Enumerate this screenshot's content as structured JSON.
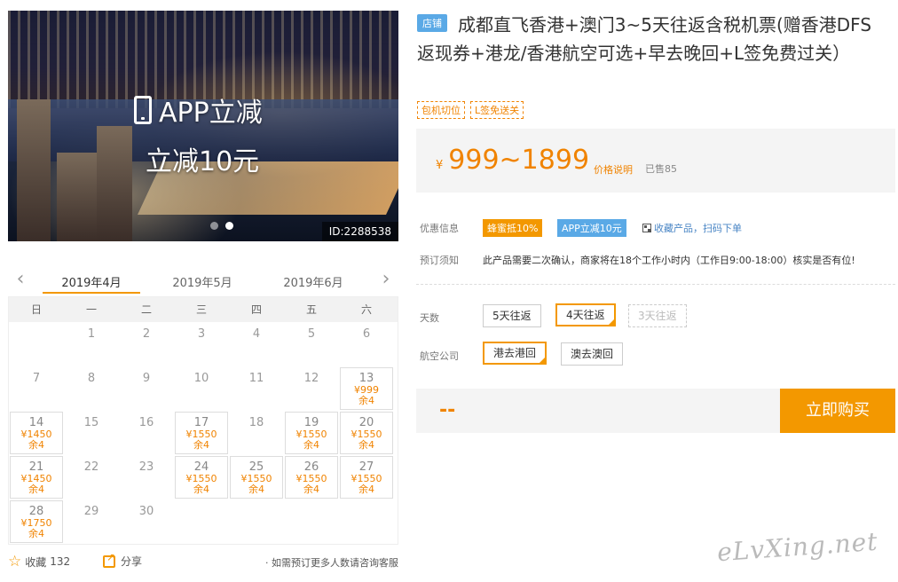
{
  "hero": {
    "app_text": "APP立减",
    "discount_text": "立减10元",
    "id_tag": "ID:2288538"
  },
  "calendar": {
    "months": [
      "2019年4月",
      "2019年5月",
      "2019年6月"
    ],
    "weekdays": [
      "日",
      "一",
      "二",
      "三",
      "四",
      "五",
      "六"
    ],
    "days": [
      {
        "d": ""
      },
      {
        "d": "1"
      },
      {
        "d": "2"
      },
      {
        "d": "3"
      },
      {
        "d": "4"
      },
      {
        "d": "5"
      },
      {
        "d": "6"
      },
      {
        "d": "7"
      },
      {
        "d": "8"
      },
      {
        "d": "9"
      },
      {
        "d": "10"
      },
      {
        "d": "11"
      },
      {
        "d": "12"
      },
      {
        "d": "13",
        "p": "¥999",
        "s": "余4"
      },
      {
        "d": "14",
        "p": "¥1450",
        "s": "余4"
      },
      {
        "d": "15"
      },
      {
        "d": "16"
      },
      {
        "d": "17",
        "p": "¥1550",
        "s": "余4"
      },
      {
        "d": "18"
      },
      {
        "d": "19",
        "p": "¥1550",
        "s": "余4"
      },
      {
        "d": "20",
        "p": "¥1550",
        "s": "余4"
      },
      {
        "d": "21",
        "p": "¥1450",
        "s": "余4"
      },
      {
        "d": "22"
      },
      {
        "d": "23"
      },
      {
        "d": "24",
        "p": "¥1550",
        "s": "余4"
      },
      {
        "d": "25",
        "p": "¥1550",
        "s": "余4"
      },
      {
        "d": "26",
        "p": "¥1550",
        "s": "余4"
      },
      {
        "d": "27",
        "p": "¥1550",
        "s": "余4"
      },
      {
        "d": "28",
        "p": "¥1750",
        "s": "余4"
      },
      {
        "d": "29"
      },
      {
        "d": "30"
      }
    ]
  },
  "bottom": {
    "fav_label": "收藏",
    "fav_count": "132",
    "share_label": "分享",
    "consult": "· 如需预订更多人数请咨询客服"
  },
  "product": {
    "shop_badge": "店铺",
    "title": "成都直飞香港+澳门3~5天往返含税机票(赠香港DFS返现券+港龙/香港航空可选+早去晚回+L签免费过关）",
    "tags": [
      "包机切位",
      "L签免送关"
    ]
  },
  "price": {
    "currency": "¥",
    "range": "999~1899",
    "explain": "价格说明",
    "sold": "已售85"
  },
  "promo": {
    "label": "优惠信息",
    "badge1": "蜂蜜抵10%",
    "badge2": "APP立减10元",
    "scan": "收藏产品，扫码下单"
  },
  "notice": {
    "label": "预订须知",
    "text": "此产品需要二次确认，商家将在18个工作小时内（工作日9:00-18:00）核实是否有位!"
  },
  "options": {
    "days_label": "天数",
    "days": [
      "5天往返",
      "4天往返",
      "3天往返"
    ],
    "airline_label": "航空公司",
    "airlines": [
      "港去港回",
      "澳去澳回"
    ]
  },
  "buy": {
    "price": "--",
    "button": "立即购买"
  },
  "watermark": "eLvXing.net"
}
